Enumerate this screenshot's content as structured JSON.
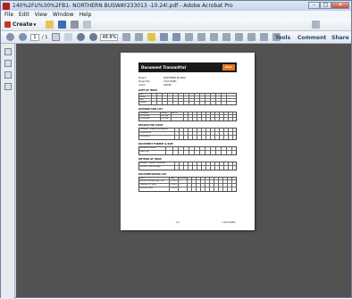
{
  "window": {
    "title": "140%2FU%30%2FB1- NORTHERN BUSWAY233013 -10.24l.pdf - Adobe Acrobat Pro",
    "minimize": "–",
    "maximize": "□",
    "close": "✕"
  },
  "menu": [
    "File",
    "Edit",
    "View",
    "Window",
    "Help"
  ],
  "toolbar": {
    "create_label": "Create",
    "page_current": "1",
    "page_total": "/ 1",
    "zoom": "48.8%",
    "tools_label": "Tools",
    "comment_label": "Comment",
    "share_label": "Share"
  },
  "colors": {
    "accent": "#2a4b73",
    "doc_bg": "#525252",
    "logo": "#e87722"
  },
  "document": {
    "header_title": "Document Transmittal",
    "logo_text": "Xtev",
    "meta": [
      {
        "label": "Project:",
        "value": "NORTHERN BUSWAY"
      },
      {
        "label": "Project No:",
        "value": "140/U30/B1"
      },
      {
        "label": "Client:",
        "value": "ODOMI"
      }
    ],
    "sections": {
      "date": "DATE OF ISSUE",
      "distribution": "DISTRIBUTION LIST",
      "reason": "REASON FOR ISSUE",
      "format": "DOCUMENT FORMAT & SIZE",
      "method": "METHOD OF ISSUE",
      "doclist": "DOCUMENTATION LIST"
    },
    "date_rows": [
      "Day",
      "Month",
      "Year",
      "Initials"
    ],
    "distribution_headers": [
      "Company",
      "Person",
      "No. of Copies"
    ],
    "distribution_rows": [
      [
        "For Record",
        "File Mgt",
        ""
      ],
      [
        "For Record",
        "File Mgt",
        ""
      ]
    ],
    "reason_rows": [
      "Planning / Design Development",
      "Construction",
      "Information"
    ],
    "format_rows": [
      "Document Format",
      "Paper Size"
    ],
    "method_rows": [
      "Internal / Courier / Electronic",
      "Transfer (Data Storage)"
    ],
    "doclist_headers": [
      "Title",
      "Dwg. No.",
      "Revision"
    ],
    "doclist_rows": [
      [
        "Northern Busway Mgt / Rev",
        "97-XXX",
        "1"
      ],
      [
        "Drawing List Sheet",
        "97-XXX",
        "1"
      ],
      [
        "Technical Note",
        "97-XXX",
        "1"
      ]
    ],
    "footer_left": "1/1",
    "footer_right": "140/U30/B1"
  }
}
